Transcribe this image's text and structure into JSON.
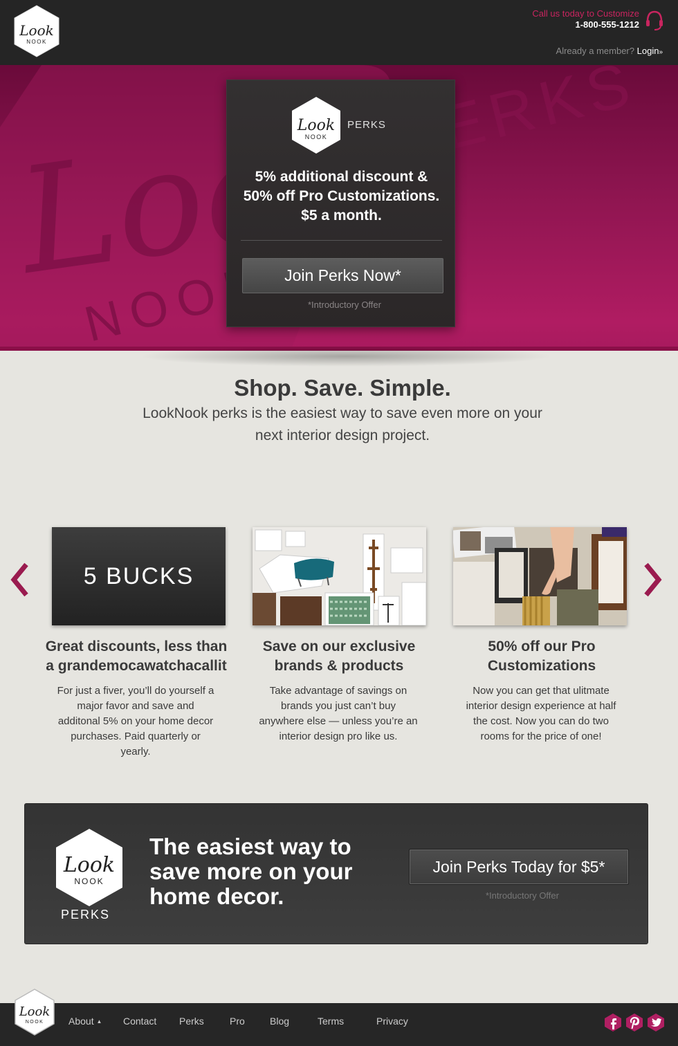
{
  "brand": {
    "logo_script": "Look",
    "logo_word": "NOOK"
  },
  "header": {
    "call_text": "Call us today to Customize",
    "phone": "1-800-555-1212",
    "member_text": "Already a member?",
    "login_label": "Login",
    "login_arrow": "»"
  },
  "hero": {
    "bg_script": "Look",
    "bg_word_nook": "NOOK",
    "bg_word_perks": "PERKS",
    "card_perks": "PERKS",
    "headline_line1": "5% additional discount &",
    "headline_line2": "50% off Pro Customizations.",
    "headline_line3": "$5 a month.",
    "join_label": "Join Perks Now*",
    "offer": "*Introductory Offer"
  },
  "intro": {
    "title": "Shop. Save. Simple.",
    "subtitle": "LookNook perks is the easiest way to save even more on your next interior design project."
  },
  "features": [
    {
      "image_text": "5 BUCKS",
      "title_line1": "Great discounts, less than",
      "title_line2": "a grandemocawatchacallit",
      "body": "For just a fiver, you’ll do yourself a major favor and save and additonal 5% on your home decor purchases. Paid quarterly or yearly."
    },
    {
      "title_line1": "Save on our exclusive",
      "title_line2": "brands & products",
      "body": "Take advantage of savings on brands you just can’t buy anywhere else — unless you’re an interior design pro like us."
    },
    {
      "title_line1": "50% off our Pro",
      "title_line2": "Customizations",
      "body": "Now you can get that ulitmate interior design experience at half the cost. Now you can do two rooms for the price of one!"
    }
  ],
  "cta": {
    "perks": "PERKS",
    "headline": "The easiest way to save more on your home decor.",
    "button": "Join Perks Today for $5*",
    "offer": "*Introductory Offer"
  },
  "footer": {
    "nav": [
      "About",
      "Contact",
      "Perks",
      "Pro",
      "Blog",
      "Terms",
      "Privacy"
    ],
    "about_caret": "▲",
    "social": [
      "facebook-icon",
      "pinterest-icon",
      "twitter-icon"
    ]
  },
  "colors": {
    "accent": "#c8255f",
    "dark": "#252525",
    "hero": "#9a1655",
    "page_bg": "#e6e5e0"
  }
}
